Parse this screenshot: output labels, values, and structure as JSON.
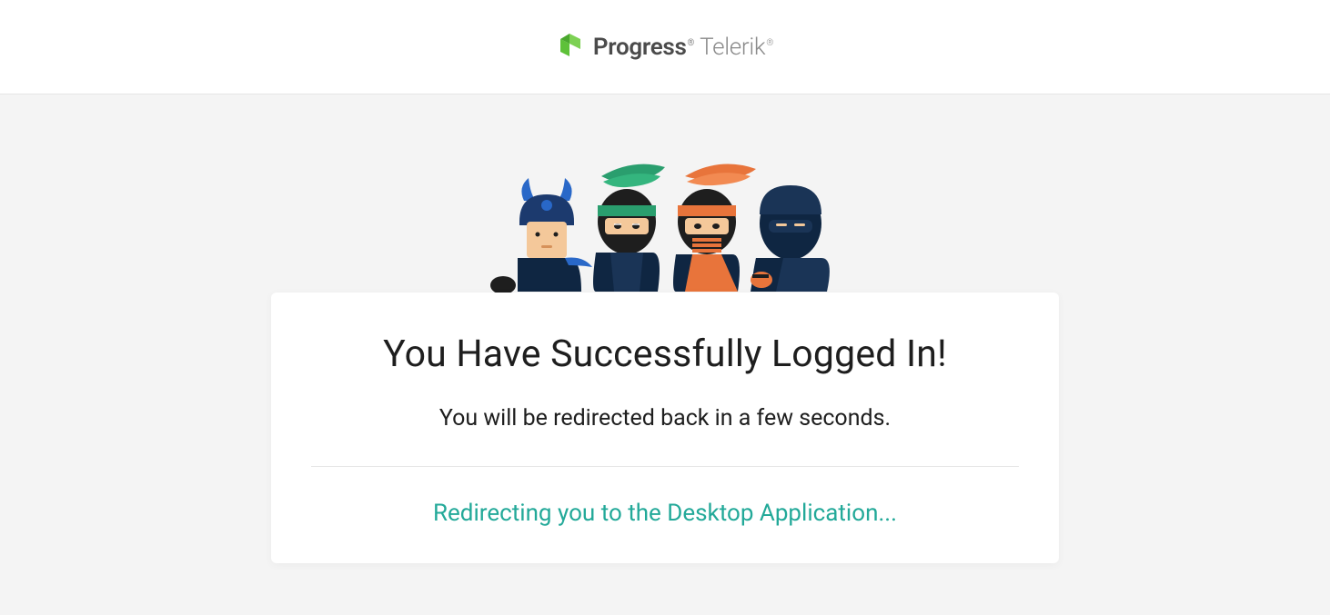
{
  "header": {
    "brand_primary": "Progress",
    "brand_secondary": "Telerik",
    "trademark": "®"
  },
  "card": {
    "title": "You Have Successfully Logged In!",
    "subtext": "You will be redirected back in a few seconds.",
    "redirect_message": "Redirecting you to the Desktop Application..."
  },
  "colors": {
    "accent_green": "#5ec139",
    "teal": "#23a999"
  }
}
